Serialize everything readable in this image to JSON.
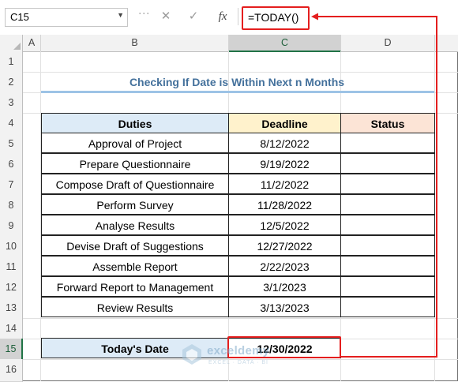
{
  "name_box": {
    "value": "C15"
  },
  "formula_bar": {
    "cancel_glyph": "✕",
    "enter_glyph": "✓",
    "fx_label": "fx",
    "formula": "=TODAY()"
  },
  "columns": [
    "A",
    "B",
    "C",
    "D"
  ],
  "rows": [
    "1",
    "2",
    "3",
    "4",
    "5",
    "6",
    "7",
    "8",
    "9",
    "10",
    "11",
    "12",
    "13",
    "14",
    "15",
    "16"
  ],
  "active_cell": {
    "column": "C",
    "row": "15"
  },
  "sheet": {
    "title": "Checking If Date is Within Next n Months",
    "headers": {
      "duties": "Duties",
      "deadline": "Deadline",
      "status": "Status"
    },
    "tasks": [
      {
        "duty": "Approval of Project",
        "deadline": "8/12/2022",
        "status": ""
      },
      {
        "duty": "Prepare Questionnaire",
        "deadline": "9/19/2022",
        "status": ""
      },
      {
        "duty": "Compose Draft of Questionnaire",
        "deadline": "11/2/2022",
        "status": ""
      },
      {
        "duty": "Perform Survey",
        "deadline": "11/28/2022",
        "status": ""
      },
      {
        "duty": "Analyse Results",
        "deadline": "12/5/2022",
        "status": ""
      },
      {
        "duty": "Devise Draft of Suggestions",
        "deadline": "12/27/2022",
        "status": ""
      },
      {
        "duty": "Assemble Report",
        "deadline": "2/22/2023",
        "status": ""
      },
      {
        "duty": "Forward Report to Management",
        "deadline": "3/1/2023",
        "status": ""
      },
      {
        "duty": "Review Results",
        "deadline": "3/13/2023",
        "status": ""
      }
    ],
    "today_label": "Today's Date",
    "today_value": "12/30/2022"
  },
  "watermark": {
    "name": "exceldemy",
    "tagline": "EXCEL · DATA · BI"
  },
  "colors": {
    "highlight_red": "#e41e1e",
    "title_blue": "#44719c",
    "header_blue": "#ddebf7",
    "header_yellow": "#fff2cc",
    "header_peach": "#fce4d6",
    "excel_green": "#217346"
  }
}
